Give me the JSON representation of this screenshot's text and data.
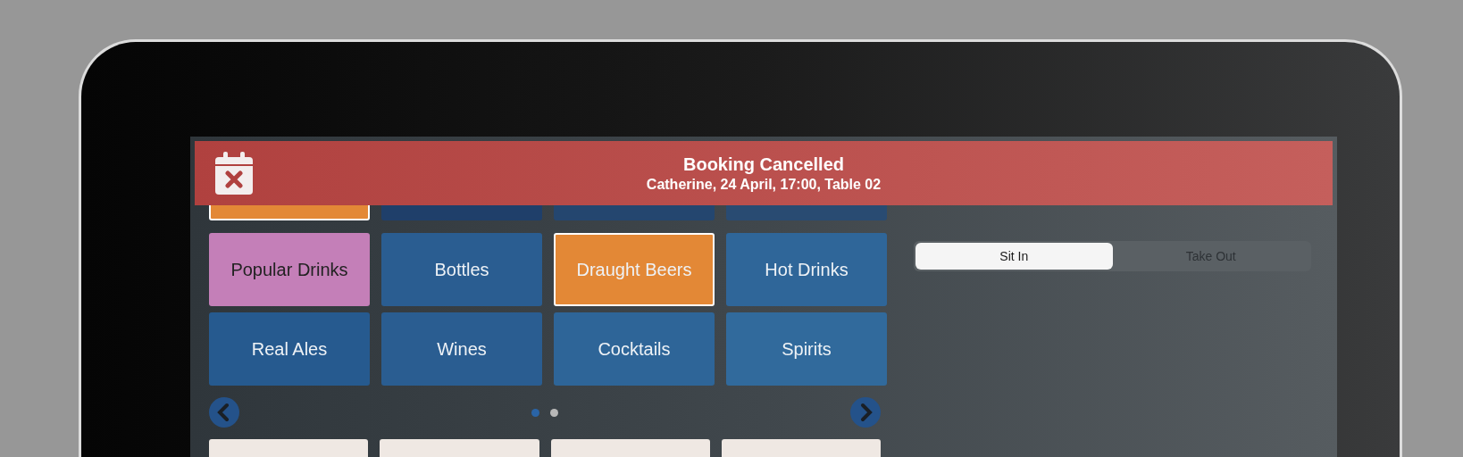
{
  "banner": {
    "title": "Booking Cancelled",
    "subtitle": "Catherine, 24 April, 17:00, Table 02"
  },
  "category_rows": [
    [
      {
        "color": "#e38836",
        "selected": true
      },
      {
        "color": "#1f3f6a",
        "selected": false
      },
      {
        "color": "#24466f",
        "selected": false
      },
      {
        "color": "#294b72",
        "selected": false
      }
    ],
    [
      {
        "label": "Popular Drinks",
        "color": "#c47fb8",
        "selected": false
      },
      {
        "label": "Bottles",
        "color": "#2a5d91",
        "selected": false
      },
      {
        "label": "Draught Beers",
        "color": "#e38836",
        "selected": true
      },
      {
        "label": "Hot Drinks",
        "color": "#2f6699",
        "selected": false
      }
    ],
    [
      {
        "label": "Real Ales",
        "color": "#265a8f",
        "selected": false
      },
      {
        "label": "Wines",
        "color": "#2a5d91",
        "selected": false
      },
      {
        "label": "Cocktails",
        "color": "#2e6598",
        "selected": false
      },
      {
        "label": "Spirits",
        "color": "#316a9c",
        "selected": false
      }
    ]
  ],
  "pager": {
    "dots": [
      {
        "selected": true
      },
      {
        "selected": false
      }
    ]
  },
  "product_tiles": [
    {
      "color": "#efe8e3"
    },
    {
      "color": "#efe8e3"
    },
    {
      "color": "#efe8e3"
    },
    {
      "color": "#efe8e3"
    }
  ],
  "order_type": [
    {
      "label": "Sit In",
      "selected": true
    },
    {
      "label": "Take Out",
      "selected": false
    }
  ]
}
